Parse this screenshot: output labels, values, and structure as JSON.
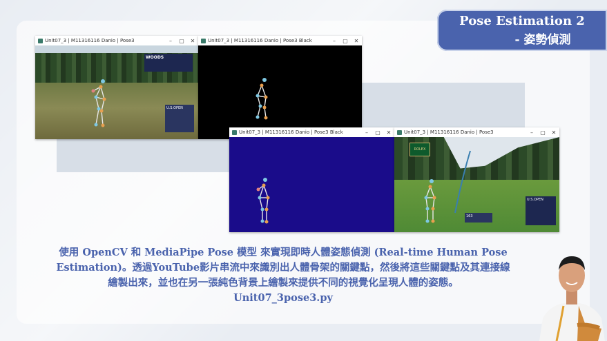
{
  "slide": {
    "title_line1": "Pose Estimation 2",
    "title_line2": "- 姿勢偵測",
    "accent_color": "#4a63ad"
  },
  "windows": [
    {
      "title": "Unit07_3 | M11316116 Danio | Pose3",
      "content": "golf-video-with-pose"
    },
    {
      "title": "Unit07_3 | M11316116 Danio | Pose3 Black",
      "content": "pose-on-black"
    },
    {
      "title": "Unit07_3 | M11316116 Danio | Pose3 Black",
      "content": "pose-on-blue"
    },
    {
      "title": "Unit07_3 | M11316116 Danio | Pose3",
      "content": "golf-video-with-pose"
    }
  ],
  "window_controls": {
    "minimize": "–",
    "maximize": "▢",
    "close": "✕"
  },
  "overlay": {
    "player_name": "WOODS",
    "usopen_label": "U.S.OPEN",
    "rolex_label": "ROLEX",
    "ball_speed": "163"
  },
  "caption": {
    "line1": "使用 OpenCV 和 MediaPipe Pose 模型 來實現即時人體姿態偵測 (Real-time Human Pose",
    "line2": "Estimation)。透過YouTube影片串流中來識別出人體骨架的關鍵點，然後將這些關鍵點及其連接線",
    "line3": "繪製出來，並也在另一張純色背景上繪製來提供不同的視覺化呈現人體的姿態。",
    "line4": "Unit07_3pose3.py"
  }
}
